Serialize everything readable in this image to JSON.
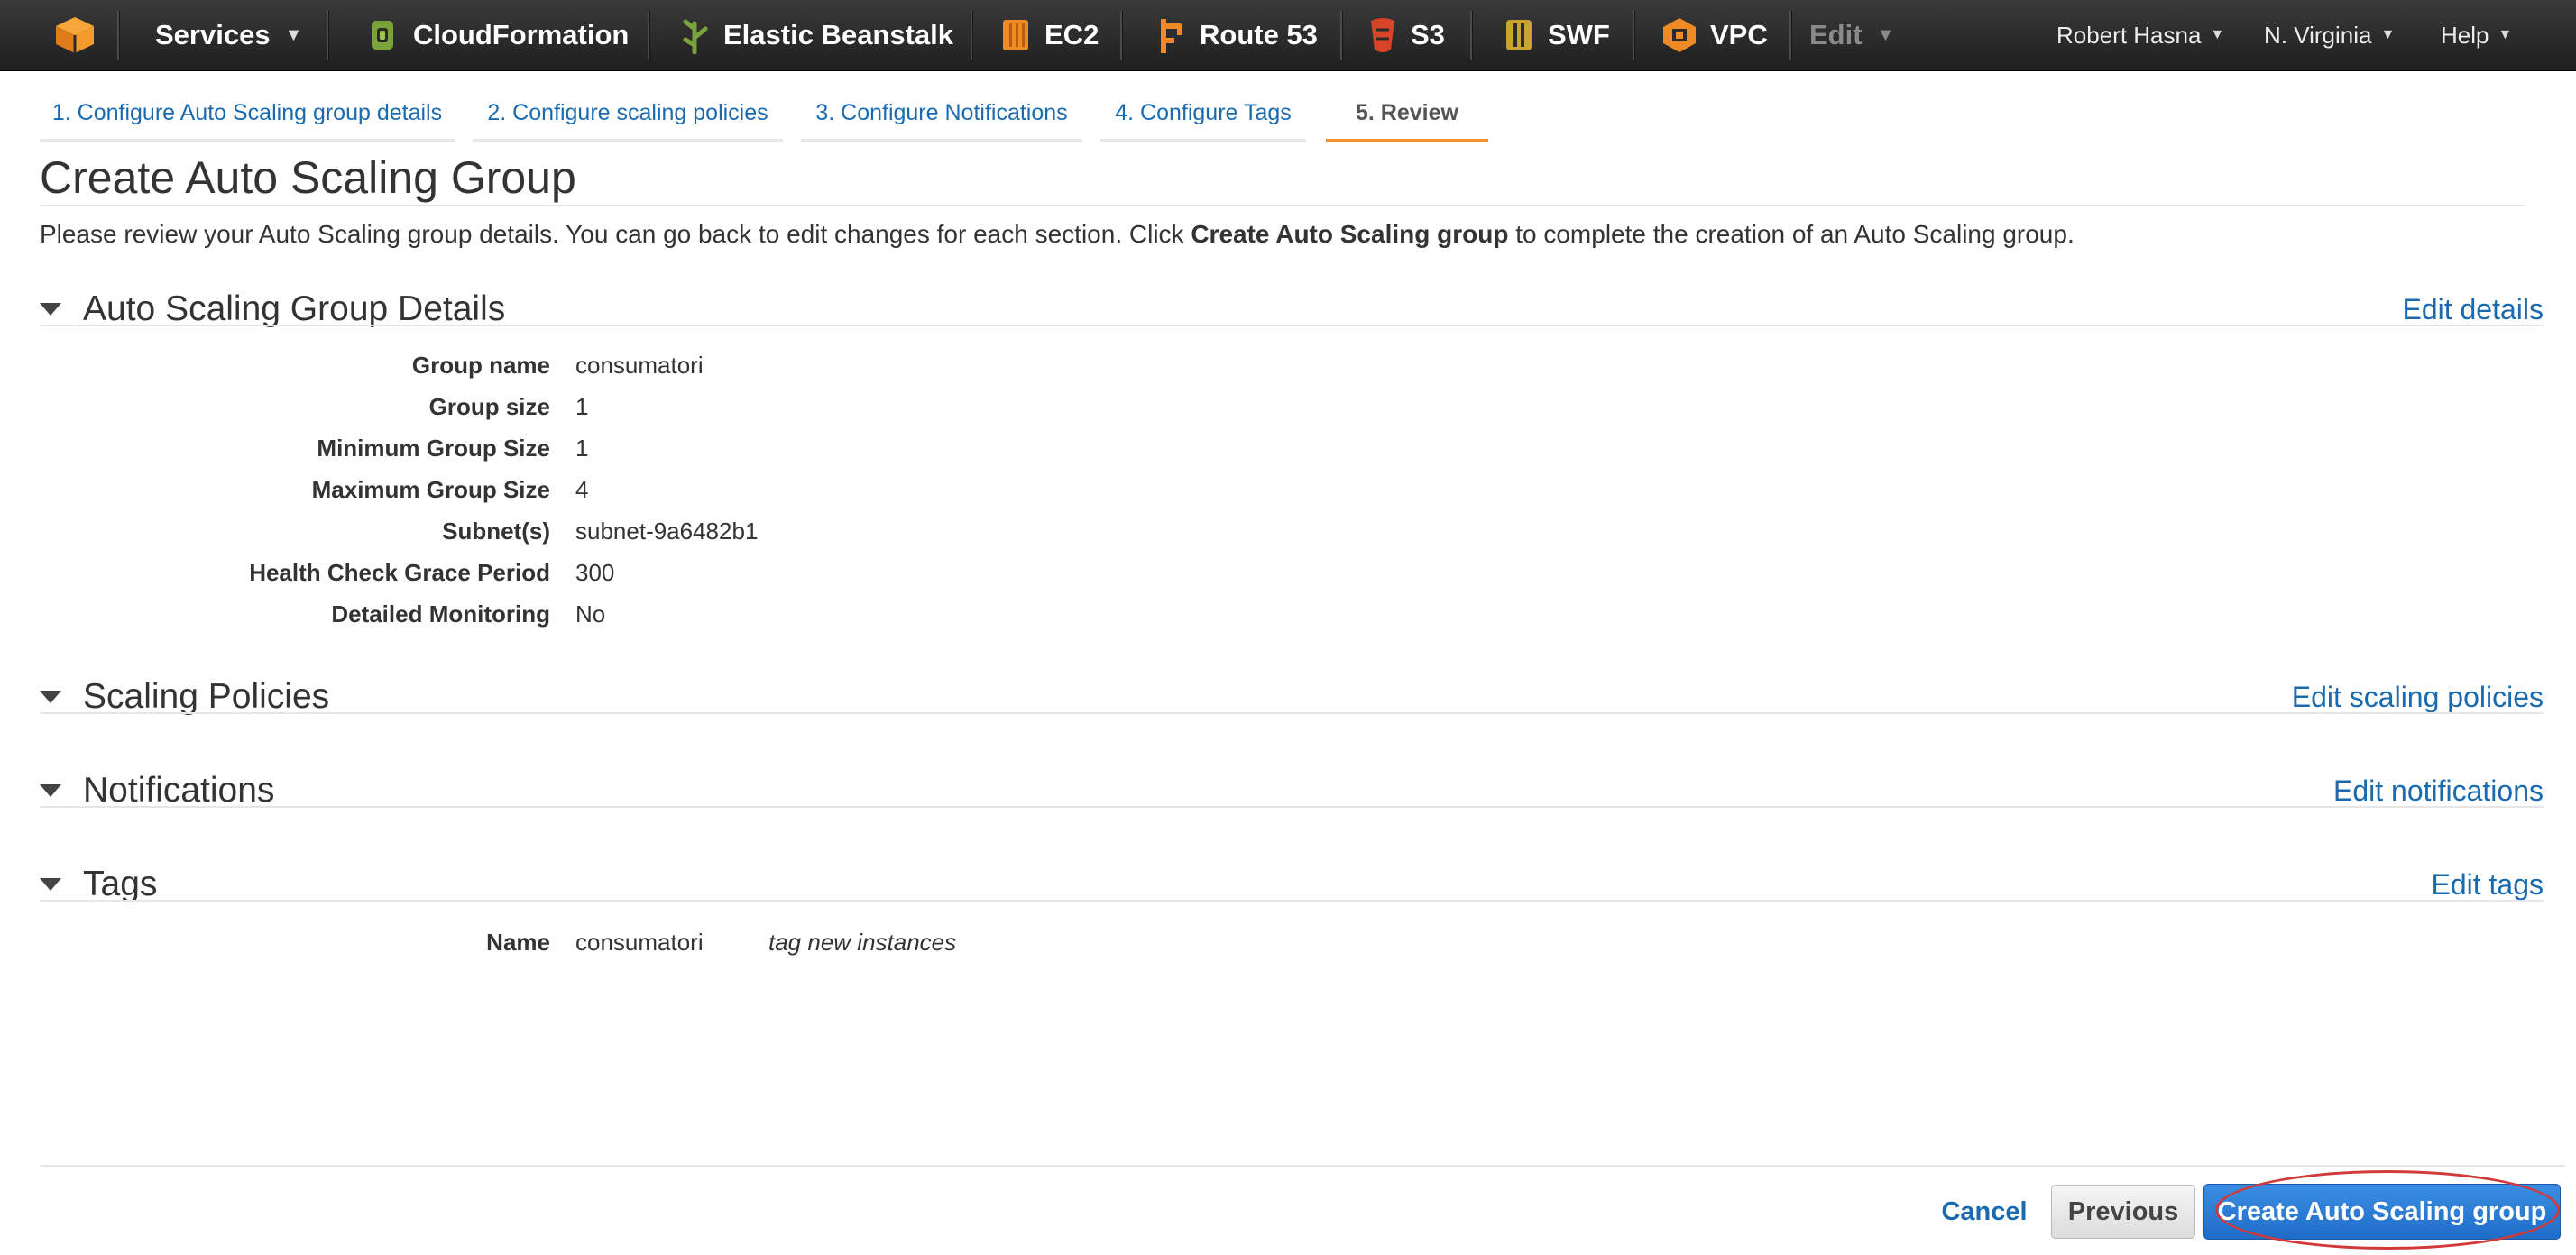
{
  "topnav": {
    "services_label": "Services",
    "services": [
      {
        "label": "CloudFormation",
        "icon": "cloudformation-icon",
        "color": "#7aa33a"
      },
      {
        "label": "Elastic Beanstalk",
        "icon": "elastic-beanstalk-icon",
        "color": "#7aa33a"
      },
      {
        "label": "EC2",
        "icon": "ec2-icon",
        "color": "#f08a24"
      },
      {
        "label": "Route 53",
        "icon": "route53-icon",
        "color": "#f08a24"
      },
      {
        "label": "S3",
        "icon": "s3-icon",
        "color": "#d9432a"
      },
      {
        "label": "SWF",
        "icon": "swf-icon",
        "color": "#c9a431"
      },
      {
        "label": "VPC",
        "icon": "vpc-icon",
        "color": "#f08a24"
      }
    ],
    "edit_label": "Edit",
    "user_label": "Robert Hasna",
    "region_label": "N. Virginia",
    "help_label": "Help"
  },
  "wizard": {
    "tabs": [
      {
        "label": "1. Configure Auto Scaling group details"
      },
      {
        "label": "2. Configure scaling policies"
      },
      {
        "label": "3. Configure Notifications"
      },
      {
        "label": "4. Configure Tags"
      },
      {
        "label": "5. Review"
      }
    ],
    "active_tab": 4
  },
  "page": {
    "title": "Create Auto Scaling Group",
    "intro_before": "Please review your Auto Scaling group details. You can go back to edit changes for each section. Click ",
    "intro_bold": "Create Auto Scaling group",
    "intro_after": " to complete the creation of an Auto Scaling group."
  },
  "details": {
    "title": "Auto Scaling Group Details",
    "edit_label": "Edit details",
    "rows": [
      {
        "label": "Group name",
        "value": "consumatori"
      },
      {
        "label": "Group size",
        "value": "1"
      },
      {
        "label": "Minimum Group Size",
        "value": "1"
      },
      {
        "label": "Maximum Group Size",
        "value": "4"
      },
      {
        "label": "Subnet(s)",
        "value": "subnet-9a6482b1"
      },
      {
        "label": "Health Check Grace Period",
        "value": "300"
      },
      {
        "label": "Detailed Monitoring",
        "value": "No"
      }
    ]
  },
  "scaling": {
    "title": "Scaling Policies",
    "edit_label": "Edit scaling policies"
  },
  "notifications": {
    "title": "Notifications",
    "edit_label": "Edit notifications"
  },
  "tags": {
    "title": "Tags",
    "edit_label": "Edit tags",
    "rows": [
      {
        "label": "Name",
        "value": "consumatori",
        "note": "tag new instances"
      }
    ]
  },
  "footer": {
    "cancel_label": "Cancel",
    "previous_label": "Previous",
    "create_label": "Create Auto Scaling group"
  },
  "colors": {
    "link": "#1a6ab0",
    "active_tab_underline": "#f0902e",
    "primary_button": "#1e6cc8",
    "highlight_ring": "#d23a3a",
    "nav_background": "#2b2b2b"
  }
}
